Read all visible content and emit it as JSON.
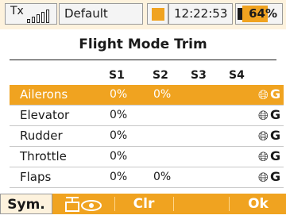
{
  "status_bar": {
    "tx_label": "Tx",
    "model_name": "Default",
    "time": "12:22:53",
    "battery_pct": "64%",
    "battery_level": 0.64,
    "accent_color": "#f0a320"
  },
  "page": {
    "title": "Flight Mode Trim"
  },
  "columns": [
    "S1",
    "S2",
    "S3",
    "S4"
  ],
  "rows": [
    {
      "name": "Ailerons",
      "s1": "0%",
      "s2": "0%",
      "s3": "",
      "s4": "",
      "icon": "globe-icon",
      "scope": "G",
      "selected": true
    },
    {
      "name": "Elevator",
      "s1": "0%",
      "s2": "",
      "s3": "",
      "s4": "",
      "icon": "globe-icon",
      "scope": "G",
      "selected": false
    },
    {
      "name": "Rudder",
      "s1": "0%",
      "s2": "",
      "s3": "",
      "s4": "",
      "icon": "globe-icon",
      "scope": "G",
      "selected": false
    },
    {
      "name": "Throttle",
      "s1": "0%",
      "s2": "",
      "s3": "",
      "s4": "",
      "icon": "globe-icon",
      "scope": "G",
      "selected": false
    },
    {
      "name": "Flaps",
      "s1": "0%",
      "s2": "0%",
      "s3": "",
      "s4": "",
      "icon": "globe-icon",
      "scope": "G",
      "selected": false
    }
  ],
  "bottom_bar": {
    "sym_label": "Sym.",
    "view_icon": "servo-eye-icon",
    "clr_label": "Clr",
    "ok_label": "Ok"
  }
}
